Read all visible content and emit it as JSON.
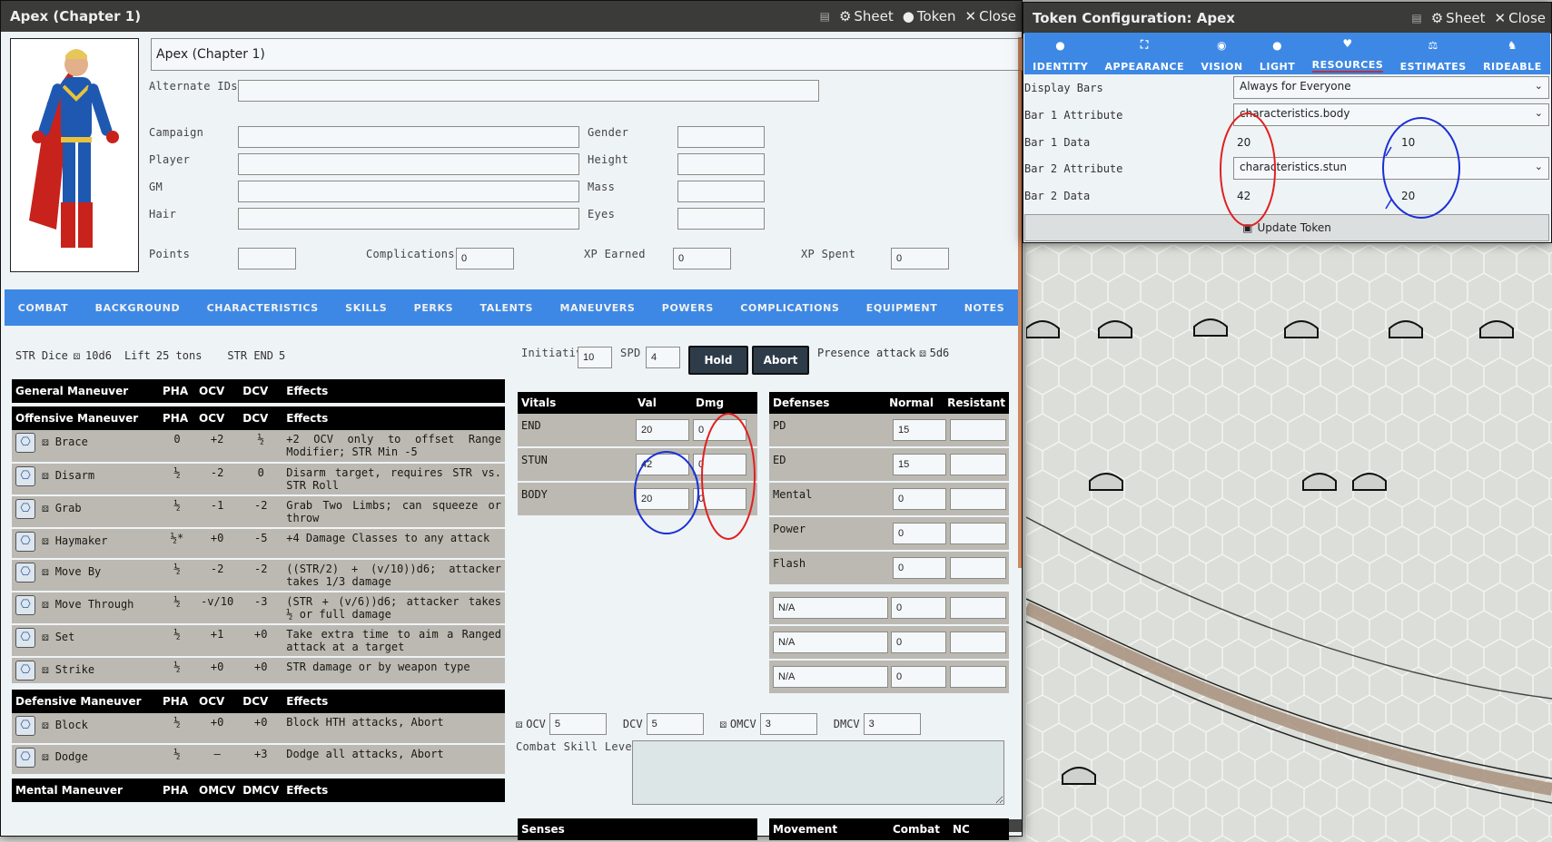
{
  "character_sheet": {
    "window_title": "Apex (Chapter 1)",
    "header_controls": {
      "sheet": "Sheet",
      "token": "Token",
      "close": "Close"
    },
    "name_value": "Apex (Chapter 1)",
    "fields": {
      "alternate_ids": {
        "label": "Alternate IDs",
        "value": ""
      },
      "campaign": {
        "label": "Campaign",
        "value": ""
      },
      "player": {
        "label": "Player",
        "value": ""
      },
      "gm": {
        "label": "GM",
        "value": ""
      },
      "hair": {
        "label": "Hair",
        "value": ""
      },
      "gender": {
        "label": "Gender",
        "value": ""
      },
      "height": {
        "label": "Height",
        "value": ""
      },
      "mass": {
        "label": "Mass",
        "value": ""
      },
      "eyes": {
        "label": "Eyes",
        "value": ""
      },
      "points": {
        "label": "Points",
        "value": ""
      },
      "complications": {
        "label": "Complications",
        "value": "0"
      },
      "xp_earned": {
        "label": "XP Earned",
        "value": "0"
      },
      "xp_spent": {
        "label": "XP Spent",
        "value": "0"
      }
    },
    "tabs": [
      "COMBAT",
      "BACKGROUND",
      "CHARACTERISTICS",
      "SKILLS",
      "PERKS",
      "TALENTS",
      "MANEUVERS",
      "POWERS",
      "COMPLICATIONS",
      "EQUIPMENT",
      "NOTES"
    ],
    "str": {
      "dice_label": "STR Dice",
      "dice_value": "10d6",
      "lift_label": "Lift",
      "lift_value": "25 tons",
      "end_label": "STR END",
      "end_value": "5"
    },
    "combat_top": {
      "initiative_label": "Initiative",
      "initiative_value": "10",
      "spd_label": "SPD",
      "spd_value": "4",
      "hold": "Hold",
      "abort": "Abort",
      "presence_label": "Presence attack",
      "presence_value": "5d6"
    },
    "general_header": [
      "General Maneuver",
      "PHA",
      "OCV",
      "DCV",
      "Effects"
    ],
    "offensive_header": [
      "Offensive Maneuver",
      "PHA",
      "OCV",
      "DCV",
      "Effects"
    ],
    "offensive": [
      {
        "name": "Brace",
        "pha": "0",
        "ocv": "+2",
        "dcv": "½",
        "effects": "+2 OCV only to offset Range Modifier; STR Min -5"
      },
      {
        "name": "Disarm",
        "pha": "½",
        "ocv": "-2",
        "dcv": "0",
        "effects": "Disarm target, requires STR vs. STR Roll"
      },
      {
        "name": "Grab",
        "pha": "½",
        "ocv": "-1",
        "dcv": "-2",
        "effects": "Grab Two Limbs; can squeeze or throw"
      },
      {
        "name": "Haymaker",
        "pha": "½*",
        "ocv": "+0",
        "dcv": "-5",
        "effects": "+4 Damage Classes to any attack"
      },
      {
        "name": "Move By",
        "pha": "½",
        "ocv": "-2",
        "dcv": "-2",
        "effects": "((STR/2) + (v/10))d6; attacker takes 1/3 damage"
      },
      {
        "name": "Move Through",
        "pha": "½",
        "ocv": "-v/10",
        "dcv": "-3",
        "effects": "(STR + (v/6))d6; attacker takes ½ or full damage"
      },
      {
        "name": "Set",
        "pha": "½",
        "ocv": "+1",
        "dcv": "+0",
        "effects": "Take extra time to aim a Ranged attack at a target"
      },
      {
        "name": "Strike",
        "pha": "½",
        "ocv": "+0",
        "dcv": "+0",
        "effects": "STR damage or by weapon type"
      }
    ],
    "defensive_header": [
      "Defensive Maneuver",
      "PHA",
      "OCV",
      "DCV",
      "Effects"
    ],
    "defensive": [
      {
        "name": "Block",
        "pha": "½",
        "ocv": "+0",
        "dcv": "+0",
        "effects": "Block HTH attacks, Abort"
      },
      {
        "name": "Dodge",
        "pha": "½",
        "ocv": "—",
        "dcv": "+3",
        "effects": "Dodge all attacks, Abort"
      }
    ],
    "mental_header": [
      "Mental Maneuver",
      "PHA",
      "OMCV",
      "DMCV",
      "Effects"
    ],
    "vitals": {
      "headers": [
        "Vitals",
        "Val",
        "Dmg"
      ],
      "rows": [
        {
          "name": "END",
          "val": "20",
          "dmg": "0"
        },
        {
          "name": "STUN",
          "val": "42",
          "dmg": "0"
        },
        {
          "name": "BODY",
          "val": "20",
          "dmg": "0"
        }
      ]
    },
    "defenses": {
      "headers": [
        "Defenses",
        "Normal",
        "Resistant"
      ],
      "rows": [
        {
          "name": "PD",
          "normal": "15",
          "resistant": ""
        },
        {
          "name": "ED",
          "normal": "15",
          "resistant": ""
        },
        {
          "name": "Mental",
          "normal": "0",
          "resistant": ""
        },
        {
          "name": "Power",
          "normal": "0",
          "resistant": ""
        },
        {
          "name": "Flash",
          "normal": "0",
          "resistant": ""
        }
      ],
      "na_rows": [
        {
          "name": "N/A",
          "normal": "0",
          "resistant": ""
        },
        {
          "name": "N/A",
          "normal": "0",
          "resistant": ""
        },
        {
          "name": "N/A",
          "normal": "0",
          "resistant": ""
        }
      ]
    },
    "cv": {
      "ocv_label": "OCV",
      "ocv_value": "5",
      "dcv_label": "DCV",
      "dcv_value": "5",
      "omcv_label": "OMCV",
      "omcv_value": "3",
      "dmcv_label": "DMCV",
      "dmcv_value": "3"
    },
    "csl_label": "Combat Skill Levels",
    "senses_header": "Senses",
    "movement_header": [
      "Movement",
      "Combat",
      "NC"
    ]
  },
  "token_config": {
    "window_title": "Token Configuration: Apex",
    "header_controls": {
      "sheet": "Sheet",
      "close": "Close"
    },
    "tabs": [
      {
        "label": "IDENTITY",
        "icon": "user-icon"
      },
      {
        "label": "APPEARANCE",
        "icon": "expand-icon"
      },
      {
        "label": "VISION",
        "icon": "eye-icon"
      },
      {
        "label": "LIGHT",
        "icon": "lightbulb-icon"
      },
      {
        "label": "RESOURCES",
        "icon": "heart-icon"
      },
      {
        "label": "ESTIMATES",
        "icon": "scale-icon"
      },
      {
        "label": "RIDEABLE",
        "icon": "horse-icon"
      }
    ],
    "display_bars": {
      "label": "Display Bars",
      "value": "Always for Everyone"
    },
    "bar1_attribute": {
      "label": "Bar 1 Attribute",
      "value": "characteristics.body"
    },
    "bar1_data": {
      "label": "Bar 1 Data",
      "value": "20",
      "max": "10"
    },
    "bar2_attribute": {
      "label": "Bar 2 Attribute",
      "value": "characteristics.stun"
    },
    "bar2_data": {
      "label": "Bar 2 Data",
      "value": "42",
      "max": "20"
    },
    "update_button": "Update Token"
  },
  "colors": {
    "accent": "#3d88e4",
    "header_bg": "#3b3b3a",
    "row_gray": "#bbb9b2",
    "annotation_red": "#e02020",
    "annotation_blue": "#1a2fd6"
  }
}
